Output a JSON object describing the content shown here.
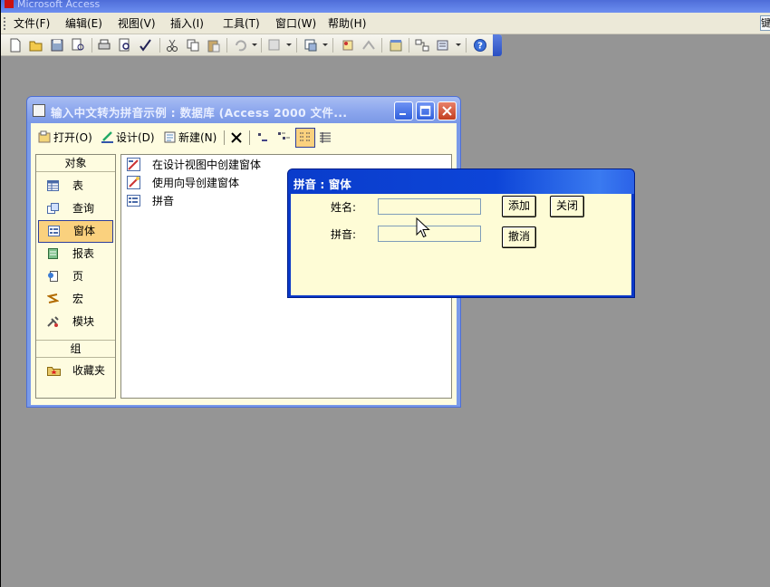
{
  "app": {
    "title": "Microsoft Access"
  },
  "menu": {
    "items": [
      "文件(F)",
      "编辑(E)",
      "视图(V)",
      "插入(I)",
      "工具(T)",
      "窗口(W)",
      "帮助(H)"
    ],
    "right_box_text": "键"
  },
  "db_window": {
    "title": "输入中文转为拼音示例 : 数据库 (Access 2000 文件...",
    "toolbar": {
      "open": "打开(O)",
      "design": "设计(D)",
      "new": "新建(N)"
    },
    "objects_header": "对象",
    "objects": [
      "表",
      "查询",
      "窗体",
      "报表",
      "页",
      "宏",
      "模块"
    ],
    "selected_object": "窗体",
    "groups_header": "组",
    "groups": [
      "收藏夹"
    ],
    "list_items": [
      "在设计视图中创建窗体",
      "使用向导创建窗体",
      "拼音"
    ]
  },
  "form_window": {
    "title": "拼音 : 窗体",
    "name_label": "姓名:",
    "name_value": "",
    "pinyin_label": "拼音:",
    "pinyin_value": "",
    "add_button": "添加",
    "close_button": "关闭",
    "undo_button": "撤消"
  },
  "colors": {
    "desktop": "#959595",
    "form_background": "#fefcd6",
    "db_title_bar": "#8ea8ee",
    "form_title_bar": "#0a3ccb",
    "selected_item": "#fad17e"
  }
}
